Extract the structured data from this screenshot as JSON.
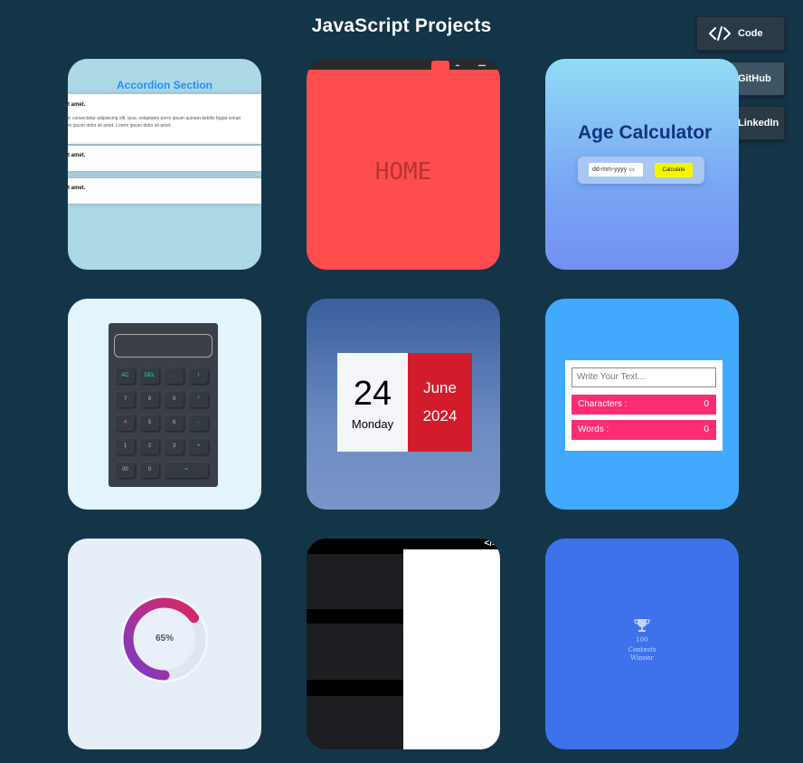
{
  "page": {
    "title": "JavaScript Projects"
  },
  "side_buttons": [
    {
      "label": "Code",
      "icon": "code-icon"
    },
    {
      "label": "GitHub",
      "icon": "github-icon"
    },
    {
      "label": "LinkedIn",
      "icon": "linkedin-icon"
    }
  ],
  "cards": {
    "accordion": {
      "title": "Accordion Section",
      "item1": "t amet.",
      "body1": "ic consectetur adipisicing elit. Ipsa, voluptates porro ipsum quinam debitis fugiat volupt",
      "body2": "m ipsum dolor sit amet. Lorem ipsum dolor sit amet.",
      "item2": "t amet.",
      "item3": "t amet."
    },
    "home": {
      "text": "HOME"
    },
    "age": {
      "title": "Age Calculator",
      "date_placeholder": "dd-mm-yyyy",
      "button": "Calculate"
    },
    "calculator": {
      "keys": [
        "AC",
        "DEL",
        ".",
        "/",
        "7",
        "8",
        "9",
        "*",
        "4",
        "5",
        "6",
        "-",
        "1",
        "2",
        "3",
        "+",
        "00",
        "0",
        "="
      ]
    },
    "date": {
      "day": "24",
      "weekday": "Monday",
      "month": "June",
      "year": "2024"
    },
    "counter": {
      "placeholder": "Write Your Text...",
      "characters_label": "Characters :",
      "characters_value": "0",
      "words_label": "Words :",
      "words_value": "0"
    },
    "progress": {
      "value_label": "65%",
      "value": 0.65
    },
    "split": {
      "code_tag": "</>"
    },
    "trophy": {
      "number": "100",
      "line1": "Contests",
      "line2": "Winner"
    }
  },
  "colors": {
    "background": "#143448",
    "accent_pink": "#fc2d70",
    "date_red": "#d21c2c"
  }
}
